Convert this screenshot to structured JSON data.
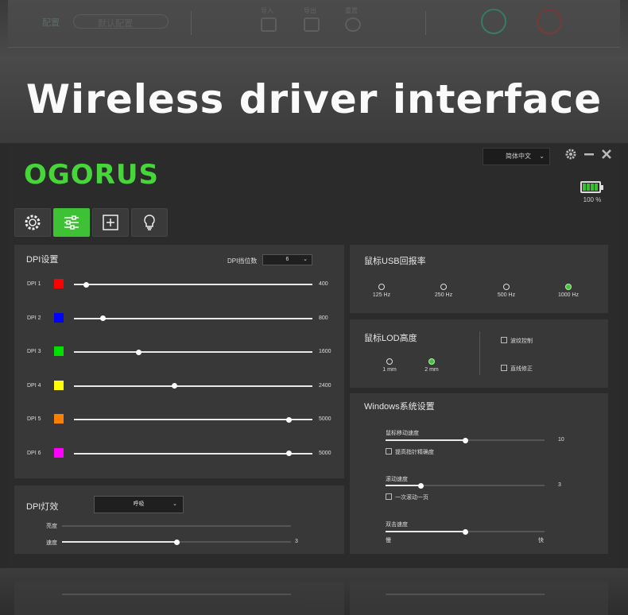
{
  "hero": {
    "title": "Wireless driver interface"
  },
  "top_toolbar": {
    "label_left": "配置",
    "profile_select": "默认配置",
    "tool_labels": [
      "导入",
      "导出",
      "重置"
    ]
  },
  "app": {
    "brand": "OGORUS",
    "language": "简体中文",
    "battery": {
      "level_percent": 100,
      "label": "100 %",
      "color": "#3ac02f"
    },
    "tabs": [
      {
        "icon": "gear-icon",
        "active": false
      },
      {
        "icon": "sliders-icon",
        "active": true
      },
      {
        "icon": "plus-square-icon",
        "active": false
      },
      {
        "icon": "lightbulb-icon",
        "active": false
      }
    ]
  },
  "dpi": {
    "title": "DPI设置",
    "gears_label": "DPI挡位数",
    "gears_value": "6",
    "max_value": 5000,
    "rows": [
      {
        "label": "DPI 1",
        "color": "#ff0000",
        "value": "400"
      },
      {
        "label": "DPI 2",
        "color": "#0000ff",
        "value": "800"
      },
      {
        "label": "DPI 3",
        "color": "#00e000",
        "value": "1600"
      },
      {
        "label": "DPI 4",
        "color": "#ffff00",
        "value": "2400"
      },
      {
        "label": "DPI 5",
        "color": "#ff8000",
        "value": "5000"
      },
      {
        "label": "DPI 6",
        "color": "#ff00ff",
        "value": "5000"
      }
    ],
    "knob_fraction": [
      0.05,
      0.12,
      0.27,
      0.42,
      0.9,
      0.9
    ]
  },
  "dpi_light": {
    "title": "DPI灯效",
    "mode": "呼吸",
    "brightness_label": "亮度",
    "speed_label": "速度",
    "speed_value": "3",
    "speed_fraction": 0.5
  },
  "usb_rate": {
    "title": "鼠标USB回报率",
    "options": [
      "125 Hz",
      "250 Hz",
      "500 Hz",
      "1000 Hz"
    ],
    "selected": 3
  },
  "lod": {
    "title": "鼠标LOD高度",
    "options": [
      "1 mm",
      "2 mm"
    ],
    "selected": 1,
    "checkboxes": [
      "波纹控制",
      "直线修正"
    ]
  },
  "windows": {
    "title": "Windows系统设置",
    "pointer_speed_label": "鼠标移动速度",
    "pointer_speed_value": "10",
    "pointer_speed_fraction": 0.5,
    "precision_label": "提高指针精确度",
    "scroll_label": "滚动速度",
    "scroll_value": "3",
    "scroll_fraction": 0.22,
    "scroll_page_label": "一次滚动一页",
    "double_click_label": "双击速度",
    "double_click_fraction": 0.5,
    "slow_label": "慢",
    "fast_label": "快"
  }
}
